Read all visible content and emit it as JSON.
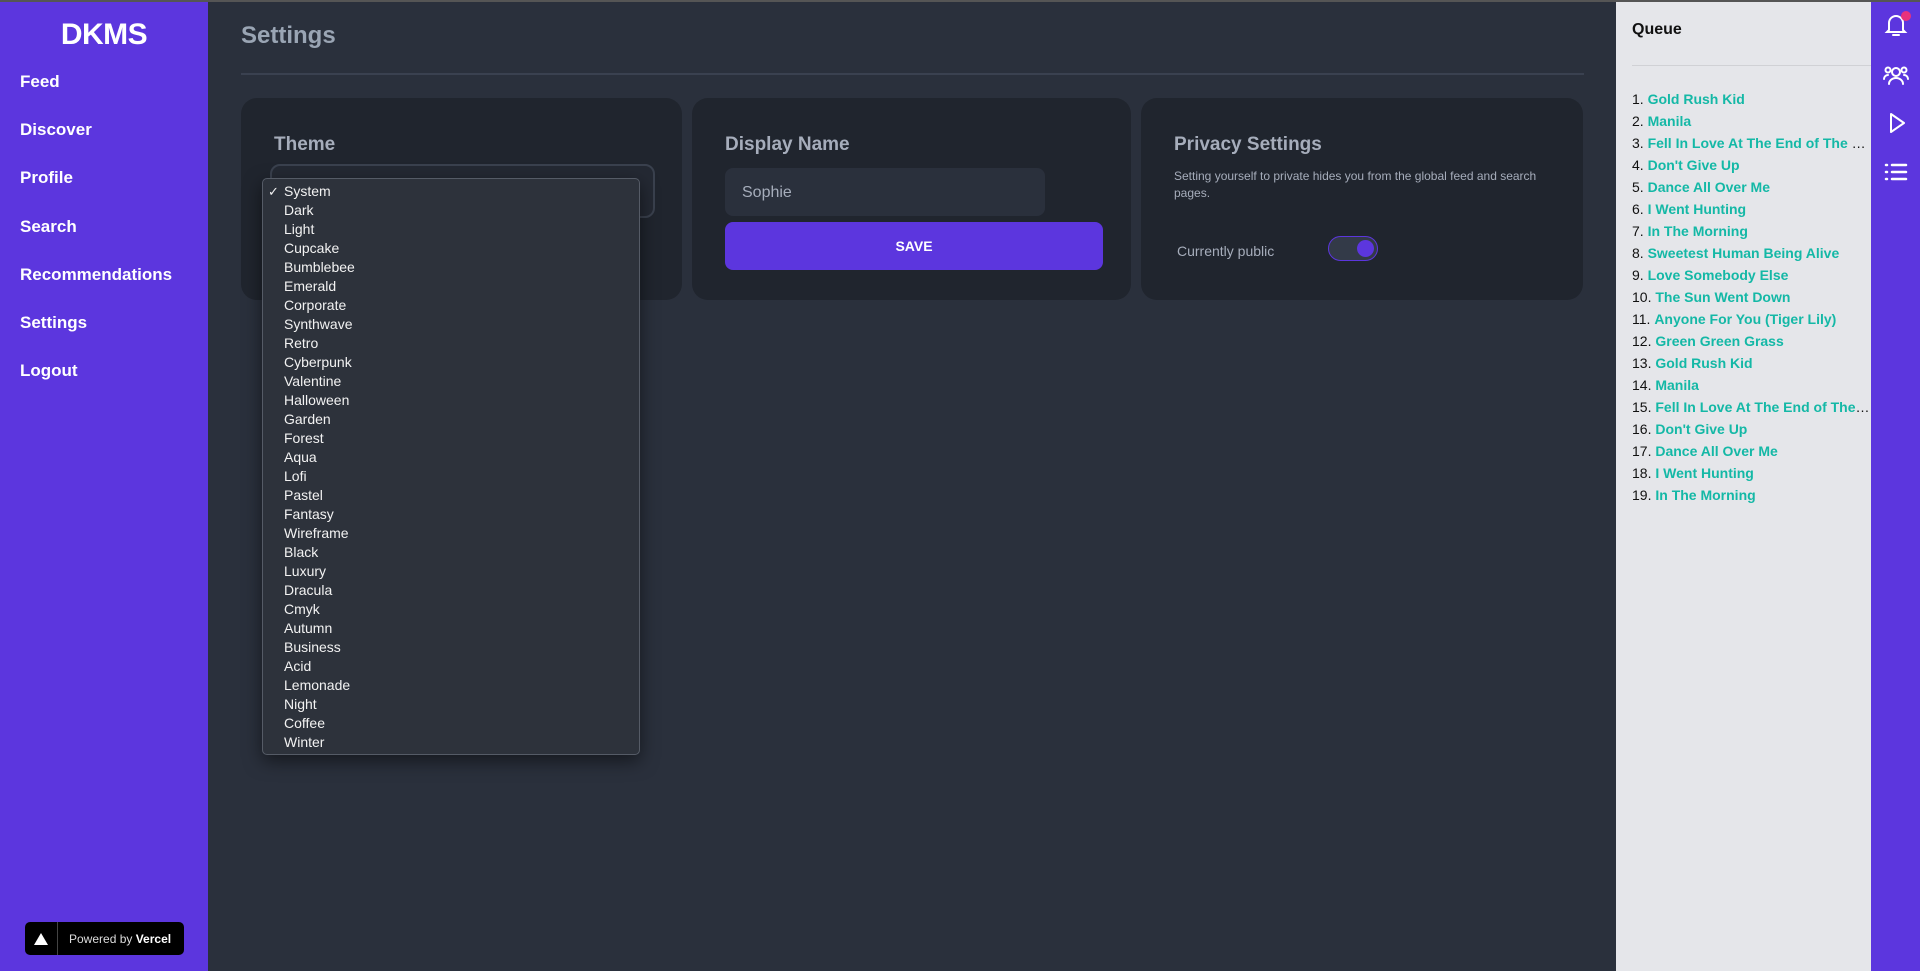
{
  "app": {
    "logo": "DKMS"
  },
  "sidebar": {
    "items": [
      {
        "label": "Feed"
      },
      {
        "label": "Discover"
      },
      {
        "label": "Profile"
      },
      {
        "label": "Search"
      },
      {
        "label": "Recommendations"
      },
      {
        "label": "Settings"
      },
      {
        "label": "Logout"
      }
    ],
    "badge": {
      "prefix": "Powered by ",
      "brand": "Vercel"
    }
  },
  "page": {
    "title": "Settings"
  },
  "theme": {
    "title": "Theme",
    "selected": "System",
    "options": [
      "System",
      "Dark",
      "Light",
      "Cupcake",
      "Bumblebee",
      "Emerald",
      "Corporate",
      "Synthwave",
      "Retro",
      "Cyberpunk",
      "Valentine",
      "Halloween",
      "Garden",
      "Forest",
      "Aqua",
      "Lofi",
      "Pastel",
      "Fantasy",
      "Wireframe",
      "Black",
      "Luxury",
      "Dracula",
      "Cmyk",
      "Autumn",
      "Business",
      "Acid",
      "Lemonade",
      "Night",
      "Coffee",
      "Winter"
    ]
  },
  "display_name": {
    "title": "Display Name",
    "value": "Sophie",
    "save_label": "SAVE"
  },
  "privacy": {
    "title": "Privacy Settings",
    "description": "Setting yourself to private hides you from the global feed and search pages.",
    "toggle_label": "Currently public",
    "is_public": true
  },
  "queue": {
    "title": "Queue",
    "items": [
      "Gold Rush Kid",
      "Manila",
      "Fell In Love At The End of The World",
      "Don't Give Up",
      "Dance All Over Me",
      "I Went Hunting",
      "In The Morning",
      "Sweetest Human Being Alive",
      "Love Somebody Else",
      "The Sun Went Down",
      "Anyone For You (Tiger Lily)",
      "Green Green Grass",
      "Gold Rush Kid",
      "Manila",
      "Fell In Love At The End of The World",
      "Don't Give Up",
      "Dance All Over Me",
      "I Went Hunting",
      "In The Morning"
    ]
  },
  "iconbar": {
    "icons": [
      "bell-icon",
      "friends-icon",
      "play-icon",
      "list-icon"
    ],
    "notification_dot": true
  },
  "colors": {
    "primary": "#5c36de",
    "accent": "#14b8a6",
    "background": "#2a303c",
    "card": "#20252e",
    "notification": "#e8327d"
  }
}
